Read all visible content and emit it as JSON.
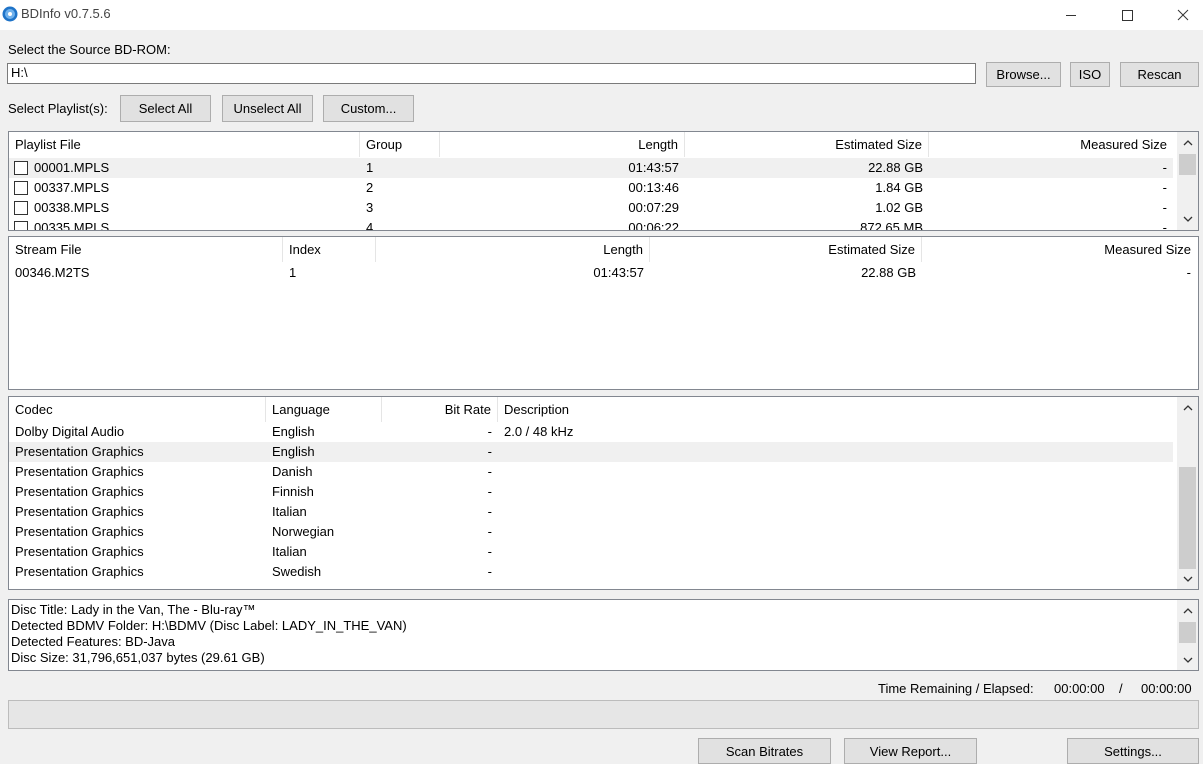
{
  "window": {
    "title": "BDInfo v0.7.5.6"
  },
  "source": {
    "label": "Select the Source BD-ROM:",
    "path": "H:\\",
    "browse_label": "Browse...",
    "iso_label": "ISO",
    "rescan_label": "Rescan"
  },
  "playlist_select": {
    "label": "Select Playlist(s):",
    "select_all_label": "Select All",
    "unselect_all_label": "Unselect All",
    "custom_label": "Custom..."
  },
  "playlists": {
    "columns": [
      "Playlist File",
      "Group",
      "Length",
      "Estimated Size",
      "Measured Size"
    ],
    "rows": [
      {
        "file": "00001.MPLS",
        "group": "1",
        "length": "01:43:57",
        "est": "22.88 GB",
        "measured": "-"
      },
      {
        "file": "00337.MPLS",
        "group": "2",
        "length": "00:13:46",
        "est": "1.84 GB",
        "measured": "-"
      },
      {
        "file": "00338.MPLS",
        "group": "3",
        "length": "00:07:29",
        "est": "1.02 GB",
        "measured": "-"
      },
      {
        "file": "00335.MPLS",
        "group": "4",
        "length": "00:06:22",
        "est": "872.65 MB",
        "measured": "-"
      }
    ]
  },
  "streams": {
    "columns": [
      "Stream File",
      "Index",
      "Length",
      "Estimated Size",
      "Measured Size"
    ],
    "rows": [
      {
        "file": "00346.M2TS",
        "index": "1",
        "length": "01:43:57",
        "est": "22.88 GB",
        "measured": "-"
      }
    ]
  },
  "codecs": {
    "columns": [
      "Codec",
      "Language",
      "Bit Rate",
      "Description"
    ],
    "rows": [
      {
        "codec": "Dolby Digital Audio",
        "language": "English",
        "bitrate": "-",
        "description": "2.0 / 48 kHz"
      },
      {
        "codec": "Presentation Graphics",
        "language": "English",
        "bitrate": "-",
        "description": ""
      },
      {
        "codec": "Presentation Graphics",
        "language": "Danish",
        "bitrate": "-",
        "description": ""
      },
      {
        "codec": "Presentation Graphics",
        "language": "Finnish",
        "bitrate": "-",
        "description": ""
      },
      {
        "codec": "Presentation Graphics",
        "language": "Italian",
        "bitrate": "-",
        "description": ""
      },
      {
        "codec": "Presentation Graphics",
        "language": "Norwegian",
        "bitrate": "-",
        "description": ""
      },
      {
        "codec": "Presentation Graphics",
        "language": "Italian",
        "bitrate": "-",
        "description": ""
      },
      {
        "codec": "Presentation Graphics",
        "language": "Swedish",
        "bitrate": "-",
        "description": ""
      }
    ]
  },
  "disc_info": {
    "lines": [
      "Disc Title: Lady in the Van, The - Blu-ray™",
      "Detected BDMV Folder: H:\\BDMV (Disc Label: LADY_IN_THE_VAN)",
      "Detected Features: BD-Java",
      "Disc Size: 31,796,651,037 bytes (29.61 GB)"
    ]
  },
  "timer": {
    "label": "Time Remaining / Elapsed:",
    "remaining": "00:00:00",
    "separator": "/",
    "elapsed": "00:00:00"
  },
  "progress": {
    "value": 0
  },
  "actions": {
    "scan_label": "Scan Bitrates",
    "view_report_label": "View Report...",
    "settings_label": "Settings..."
  }
}
